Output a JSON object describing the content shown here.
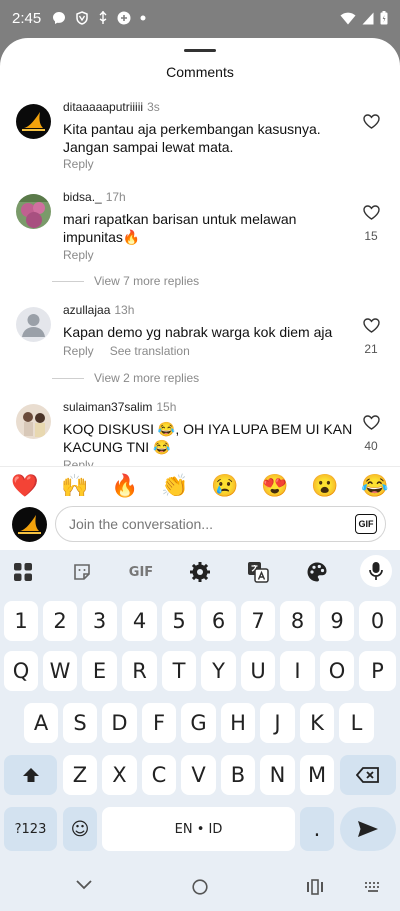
{
  "status": {
    "time": "2:45"
  },
  "sheet": {
    "title": "Comments"
  },
  "comments": [
    {
      "user": "ditaaaaaputriiiii",
      "time": "3s",
      "text": "Kita pantau aja perkembangan kasusnya. Jangan sampai lewat mata.",
      "reply": "Reply",
      "likes": ""
    },
    {
      "user": "bidsa._",
      "time": "17h",
      "text": "mari rapatkan barisan untuk melawan impunitas🔥",
      "reply": "Reply",
      "likes": "15",
      "view_replies": "View 7 more replies"
    },
    {
      "user": "azullajaa",
      "time": "13h",
      "text": "Kapan demo yg nabrak warga kok diem aja",
      "reply": "Reply",
      "see_translation": "See translation",
      "likes": "21",
      "view_replies": "View 2 more replies"
    },
    {
      "user": "sulaiman37salim",
      "time": "15h",
      "text": "KOQ DISKUSI 😂, OH IYA LUPA BEM UI KAN KACUNG TNI 😂",
      "reply": "Reply",
      "likes": "40"
    }
  ],
  "emoji_bar": [
    "❤️",
    "🙌",
    "🔥",
    "👏",
    "😢",
    "😍",
    "😮",
    "😂"
  ],
  "compose": {
    "placeholder": "Join the conversation...",
    "gif_label": "GIF"
  },
  "keyboard": {
    "toolbar_gif": "GIF",
    "row_numbers": [
      "1",
      "2",
      "3",
      "4",
      "5",
      "6",
      "7",
      "8",
      "9",
      "0"
    ],
    "row_1": [
      "Q",
      "W",
      "E",
      "R",
      "T",
      "Y",
      "U",
      "I",
      "O",
      "P"
    ],
    "row_2": [
      "A",
      "S",
      "D",
      "F",
      "G",
      "H",
      "J",
      "K",
      "L"
    ],
    "row_3": [
      "Z",
      "X",
      "C",
      "V",
      "B",
      "N",
      "M"
    ],
    "symbols_key": "?123",
    "emoji_key": "☺",
    "space_label": "EN • ID",
    "period_key": "."
  }
}
